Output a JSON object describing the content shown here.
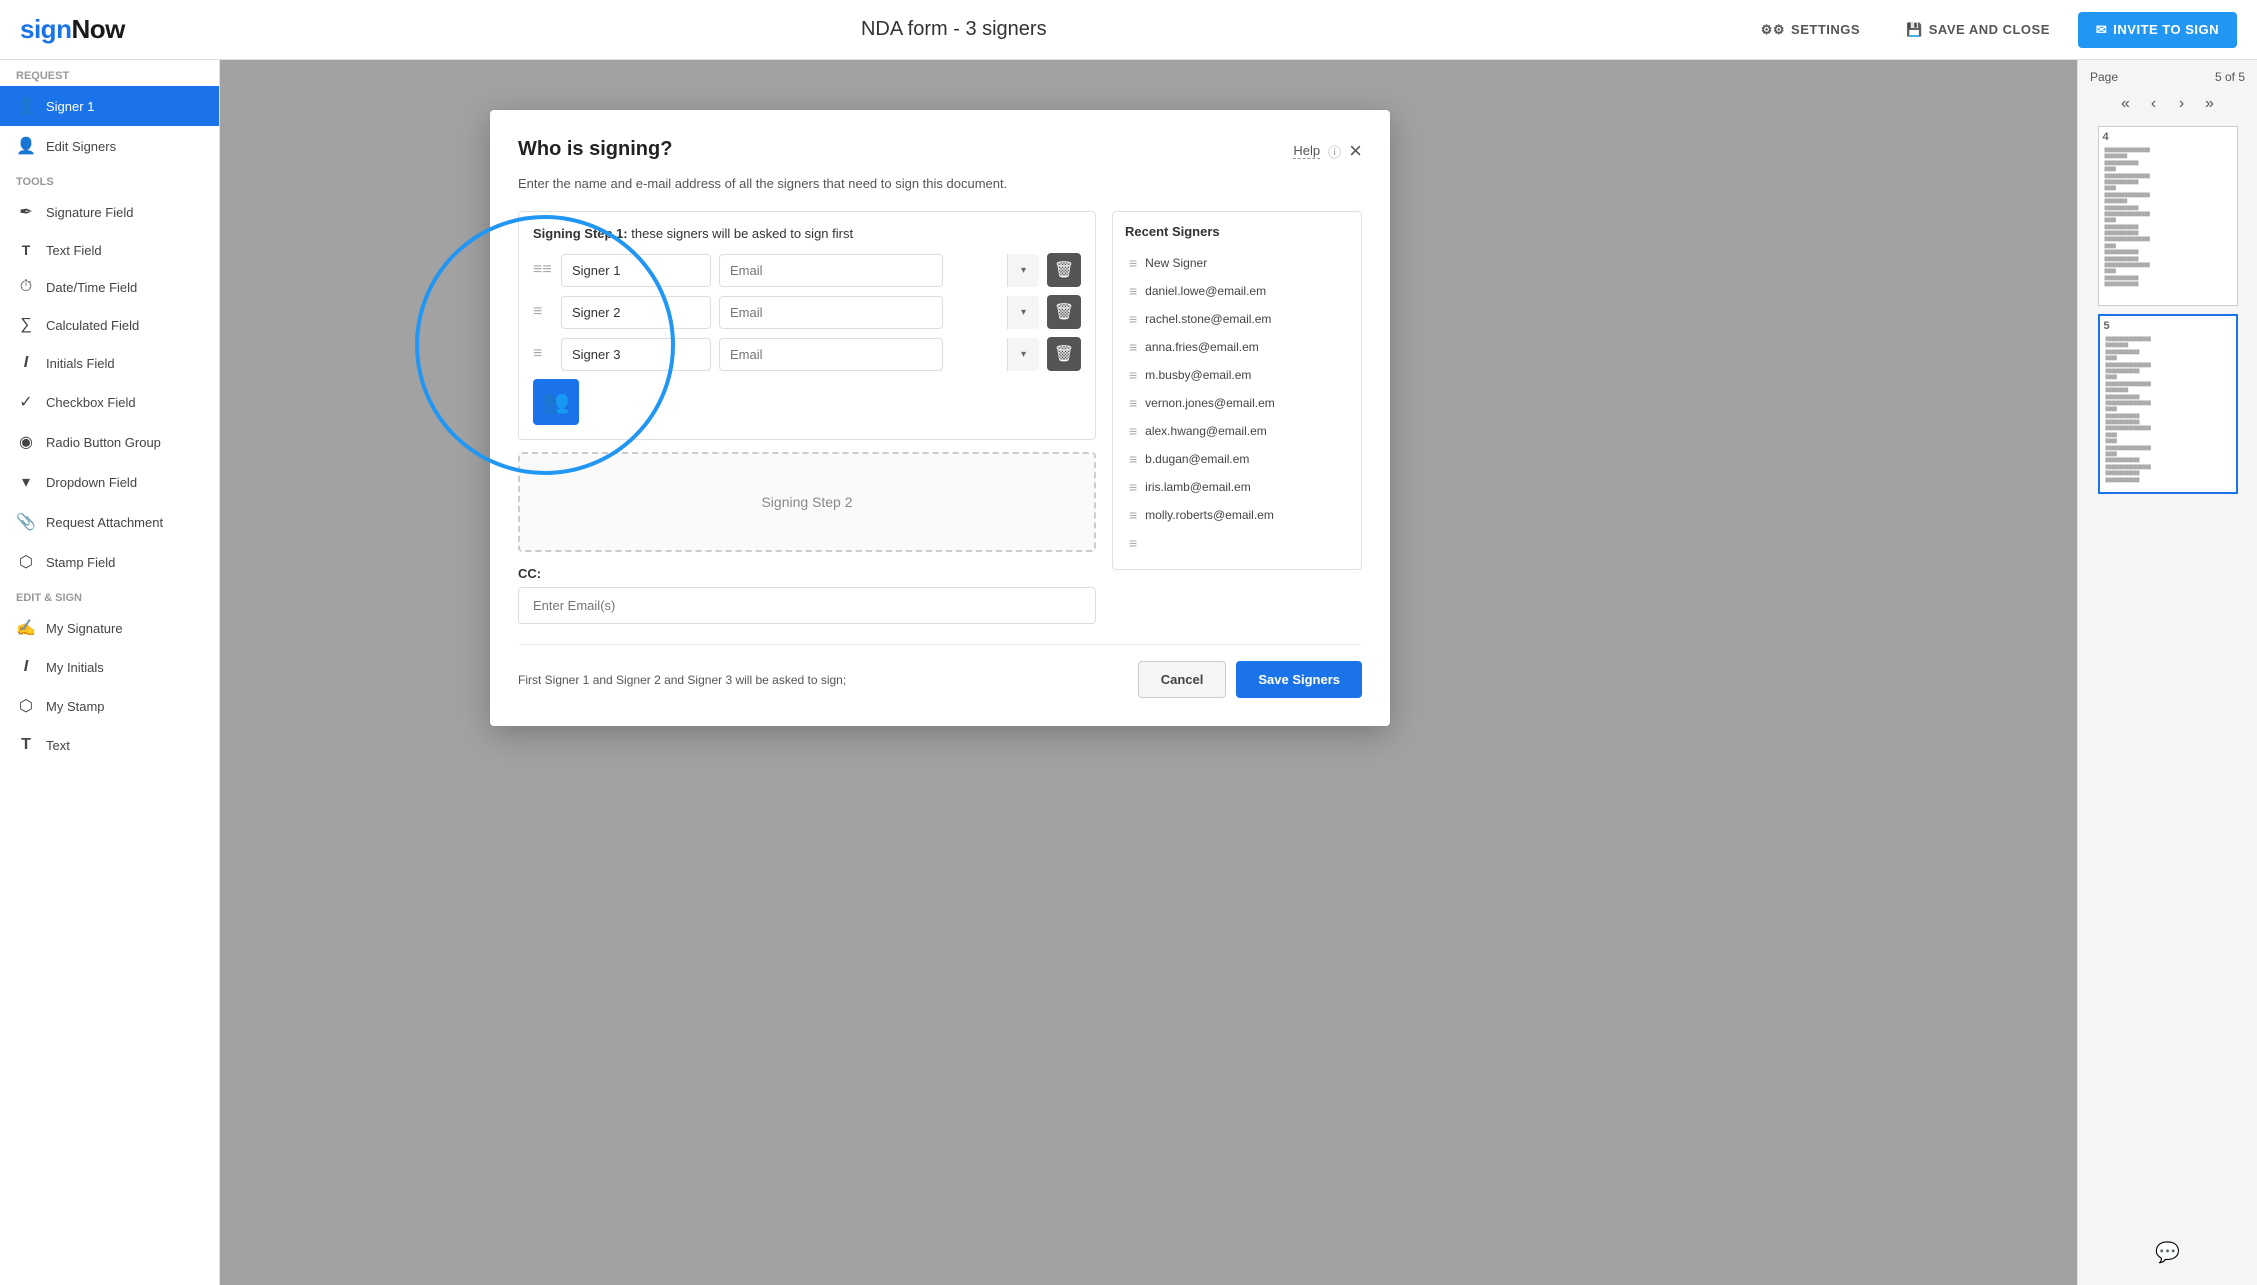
{
  "app": {
    "logo_blue": "sign",
    "logo_black": "Now",
    "title": "NDA form - 3 signers"
  },
  "topbar": {
    "settings_label": "SETTINGS",
    "save_label": "SAVE AND CLOSE",
    "invite_label": "INVITE TO SIGN"
  },
  "sidebar": {
    "request_label": "Request",
    "signer1_label": "Signer 1",
    "edit_signers_label": "Edit Signers",
    "tools_label": "Tools",
    "tools": [
      {
        "icon": "pen",
        "label": "Signature Field"
      },
      {
        "icon": "text",
        "label": "Text Field"
      },
      {
        "icon": "date",
        "label": "Date/Time Field"
      },
      {
        "icon": "calc",
        "label": "Calculated Field"
      },
      {
        "icon": "initials",
        "label": "Initials Field"
      },
      {
        "icon": "check",
        "label": "Checkbox Field"
      },
      {
        "icon": "radio",
        "label": "Radio Button Group"
      },
      {
        "icon": "dropdown",
        "label": "Dropdown Field"
      },
      {
        "icon": "attach",
        "label": "Request Attachment"
      },
      {
        "icon": "stamp",
        "label": "Stamp Field"
      }
    ],
    "edit_sign_label": "Edit & Sign",
    "edit_sign_items": [
      {
        "icon": "sig",
        "label": "My Signature"
      },
      {
        "icon": "initials",
        "label": "My Initials"
      },
      {
        "icon": "stamp",
        "label": "My Stamp"
      },
      {
        "icon": "mytext",
        "label": "Text"
      }
    ]
  },
  "right_panel": {
    "page_label": "Page",
    "page_current": "5 of 5",
    "thumbs": [
      {
        "num": "4"
      },
      {
        "num": "5"
      }
    ]
  },
  "modal": {
    "title": "Who is signing?",
    "help_label": "Help",
    "subtitle": "Enter the name and e-mail address of all the signers that need to sign this document.",
    "step1_label": "Signing Step 1:",
    "step1_desc": "these signers will be asked to sign first",
    "step2_label": "Signing Step 2",
    "signers": [
      {
        "name": "Signer 1",
        "email": ""
      },
      {
        "name": "Signer 2",
        "email": ""
      },
      {
        "name": "Signer 3",
        "email": ""
      }
    ],
    "email_placeholder": "Email",
    "cc_label": "CC:",
    "cc_placeholder": "Enter Email(s)",
    "footer_summary": "First Signer 1 and Signer 2 and Signer 3 will be asked to sign;",
    "cancel_label": "Cancel",
    "save_signers_label": "Save Signers"
  },
  "recent_signers": {
    "title": "Recent Signers",
    "items": [
      {
        "label": "New Signer"
      },
      {
        "label": "daniel.lowe@email.em"
      },
      {
        "label": "rachel.stone@email.em"
      },
      {
        "label": "anna.fries@email.em"
      },
      {
        "label": "m.busby@email.em"
      },
      {
        "label": "vernon.jones@email.em"
      },
      {
        "label": "alex.hwang@email.em"
      },
      {
        "label": "b.dugan@email.em"
      },
      {
        "label": "iris.lamb@email.em"
      },
      {
        "label": "molly.roberts@email.em"
      },
      {
        "label": ""
      }
    ]
  }
}
